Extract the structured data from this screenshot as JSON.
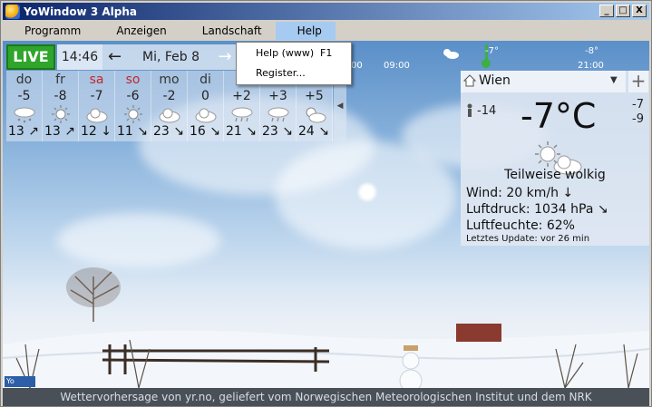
{
  "window": {
    "title": "YoWindow 3 Alpha",
    "controls": {
      "minimize": "_",
      "maximize": "□",
      "close": "X"
    }
  },
  "menubar": {
    "items": [
      "Programm",
      "Anzeigen",
      "Landschaft",
      "Help"
    ],
    "active": "Help"
  },
  "help_menu": {
    "items": [
      {
        "label": "Help (www)",
        "shortcut": "F1"
      },
      {
        "label": "Register...",
        "shortcut": ""
      }
    ]
  },
  "topbar": {
    "live_label": "LIVE",
    "time": "14:46",
    "prev_arrow": "←",
    "date": "Mi, Feb 8",
    "next_arrow": "→",
    "timeline_labels": [
      "00",
      "09:00",
      "-8°",
      "21:00"
    ],
    "timeline_marker": "-7°"
  },
  "days": [
    {
      "name": "do",
      "weekend": false,
      "temp": "-5",
      "icon": "snow-cloud-icon",
      "wind": "13",
      "dir": "↗"
    },
    {
      "name": "fr",
      "weekend": false,
      "temp": "-8",
      "icon": "sun-icon",
      "wind": "13",
      "dir": "↗"
    },
    {
      "name": "sa",
      "weekend": true,
      "temp": "-7",
      "icon": "cloud-icon",
      "wind": "12",
      "dir": "↓"
    },
    {
      "name": "so",
      "weekend": true,
      "temp": "-6",
      "icon": "sun-icon",
      "wind": "11",
      "dir": "↘"
    },
    {
      "name": "mo",
      "weekend": false,
      "temp": "-2",
      "icon": "cloud-icon",
      "wind": "23",
      "dir": "↘"
    },
    {
      "name": "di",
      "weekend": false,
      "temp": "0",
      "icon": "cloud-icon",
      "wind": "16",
      "dir": "↘"
    },
    {
      "name": "",
      "weekend": false,
      "temp": "+2",
      "icon": "rain-cloud-icon",
      "wind": "21",
      "dir": "↘"
    },
    {
      "name": "",
      "weekend": false,
      "temp": "+3",
      "icon": "rain-cloud-icon",
      "wind": "23",
      "dir": "↘"
    },
    {
      "name": "",
      "weekend": false,
      "temp": "+5",
      "icon": "partly-cloudy-icon",
      "wind": "24",
      "dir": "↘"
    }
  ],
  "current": {
    "city": "Wien",
    "add_label": "+",
    "feels_like": "-14",
    "temp": "-7°C",
    "high": "-7",
    "low": "-9",
    "condition": "Teilweise wolkig",
    "wind": "Wind:  20 km/h  ↓",
    "pressure": "Luftdruck:  1034 hPa  ↘",
    "humidity": "Luftfeuchte:  62%",
    "updated": "Letztes Update:  vor 26 min"
  },
  "brand_label": "Yo",
  "footer": "Wettervorhersage von yr.no, geliefert vom Norwegischen Meteorologischen Institut und dem NRK",
  "colors": {
    "live": "#2fa52b",
    "weekend": "#c0282d",
    "titlebar_start": "#0a246a",
    "menu_highlight": "#a6caf0"
  }
}
